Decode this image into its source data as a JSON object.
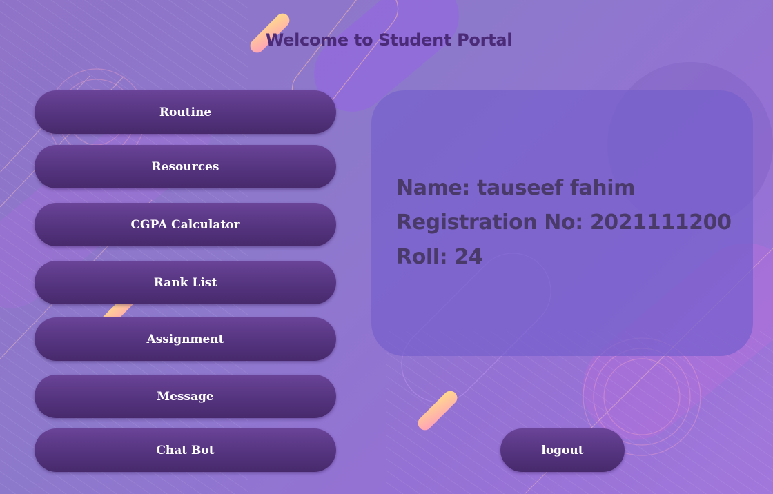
{
  "header": {
    "title": "Welcome to Student Portal"
  },
  "nav": {
    "items": [
      {
        "id": "routine",
        "label": "Routine"
      },
      {
        "id": "resources",
        "label": "Resources"
      },
      {
        "id": "cgpa-calculator",
        "label": "CGPA Calculator"
      },
      {
        "id": "rank-list",
        "label": "Rank List"
      },
      {
        "id": "assignment",
        "label": "Assignment"
      },
      {
        "id": "message",
        "label": "Message"
      },
      {
        "id": "chat-bot",
        "label": "Chat Bot"
      }
    ]
  },
  "profile": {
    "name_line": "Name: tauseef fahim",
    "registration_line": "Registration No: 2021111200",
    "roll_line": "Roll: 24"
  },
  "actions": {
    "logout_label": "logout"
  },
  "colors": {
    "background": "#8f73c8",
    "button": "#55347f",
    "title_text": "#4b2a78",
    "card": "#7660cc",
    "accent_yellow": "#ffd98a",
    "accent_pink": "#ff9fb8"
  }
}
